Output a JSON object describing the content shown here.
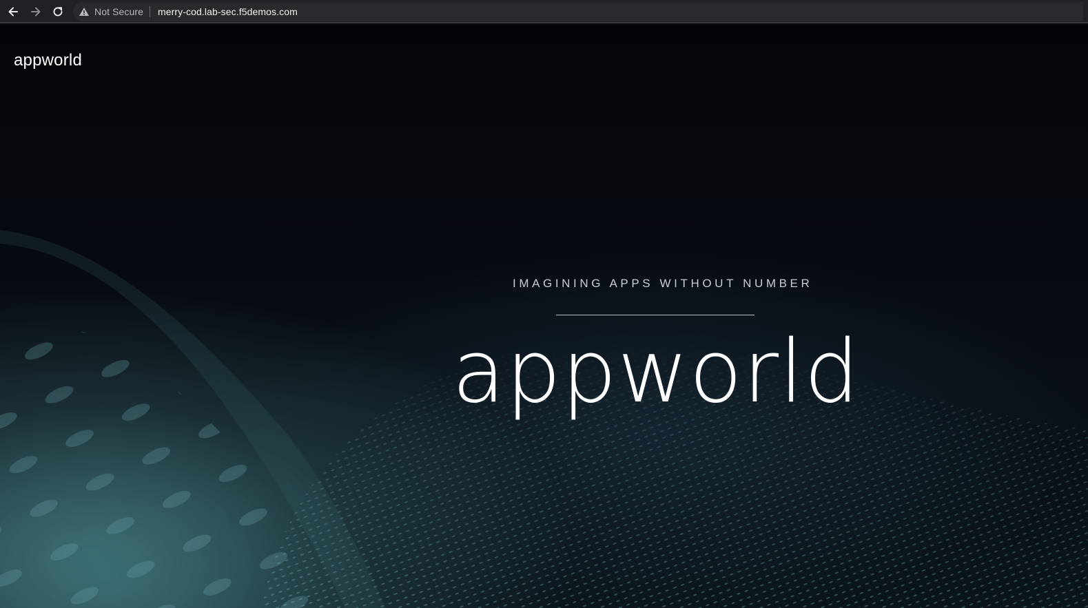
{
  "browser": {
    "back_icon": "arrow-left-icon",
    "forward_icon": "arrow-right-icon",
    "reload_icon": "reload-icon",
    "security_icon": "warning-triangle-icon",
    "security_label": "Not Secure",
    "url": "merry-cod.lab-sec.f5demos.com"
  },
  "site": {
    "logo_text": "appworld"
  },
  "hero": {
    "tagline": "IMAGINING APPS WITHOUT NUMBER",
    "title": "appworld"
  },
  "colors": {
    "background": "#05070b",
    "text": "#ffffff",
    "tagline": "#c9ccd1",
    "accent_teal": "#4f8f94"
  }
}
